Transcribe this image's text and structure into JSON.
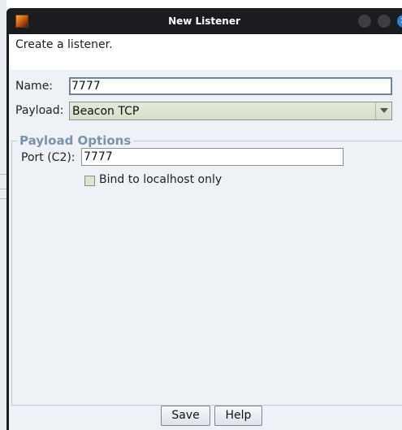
{
  "window": {
    "title": "New Listener",
    "icons": {
      "app": "app-icon",
      "minimize": "minimize-icon",
      "maximize": "maximize-icon",
      "close": "close-icon"
    }
  },
  "intro": {
    "text": "Create a listener."
  },
  "form": {
    "name": {
      "label": "Name:",
      "value": "7777"
    },
    "payload": {
      "label": "Payload:",
      "value": "Beacon TCP",
      "arrow_icon": "chevron-down-icon"
    }
  },
  "payload_options": {
    "title": "Payload Options",
    "port": {
      "label": "Port (C2):",
      "value": "7777"
    },
    "bind_localhost": {
      "label": "Bind to localhost only",
      "checked": false
    }
  },
  "buttons": {
    "save": "Save",
    "help": "Help"
  },
  "colors": {
    "titlebar": "#1b1c1f",
    "panel": "#eef1f5",
    "section_title": "#7a93ad",
    "select_bg": "#dce4d0",
    "close_button": "#2f7fd6"
  }
}
